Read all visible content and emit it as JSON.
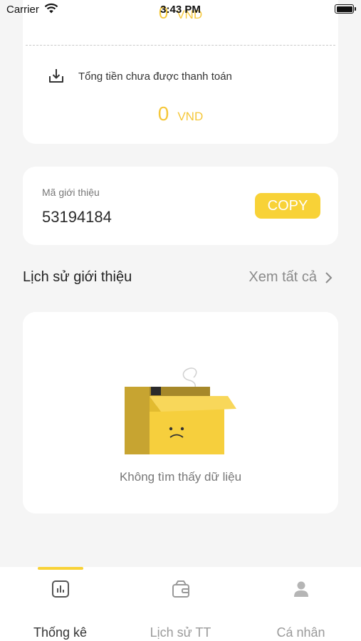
{
  "status_bar": {
    "carrier": "Carrier",
    "time": "3:43 PM"
  },
  "summary": {
    "top_amount": "0",
    "top_unit": "VND",
    "unpaid_label": "Tổng tiền chưa được thanh toán",
    "unpaid_amount": "0",
    "unpaid_unit": "VND",
    "accent_color": "#f5c73a"
  },
  "referral": {
    "label": "Mã giới thiệu",
    "code": "53194184",
    "copy_label": "COPY"
  },
  "history": {
    "title": "Lịch sử giới thiệu",
    "see_all": "Xem tất cả",
    "empty_text": "Không tìm thấy dữ liệu"
  },
  "tabs": [
    {
      "label": "Thống kê",
      "icon": "chart-icon",
      "active": true
    },
    {
      "label": "Lịch sử TT",
      "icon": "wallet-icon",
      "active": false
    },
    {
      "label": "Cá nhân",
      "icon": "person-icon",
      "active": false
    }
  ]
}
